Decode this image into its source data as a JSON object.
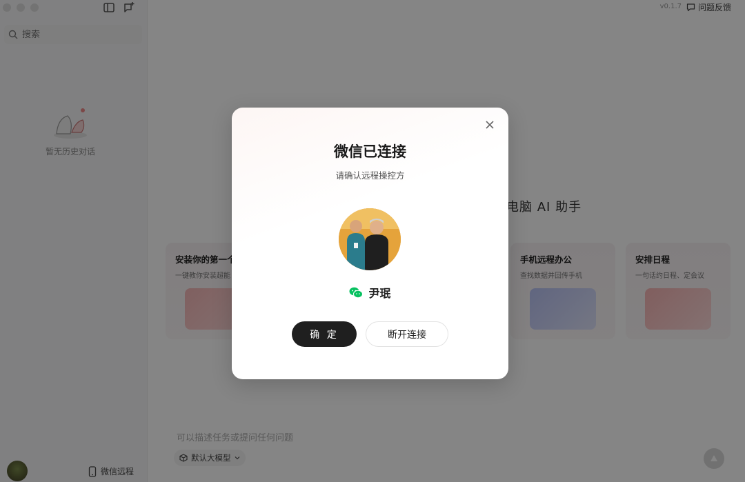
{
  "sidebar": {
    "search_placeholder": "搜索",
    "empty_history": "暂无历史对话",
    "wechat_remote": "微信远程"
  },
  "header": {
    "version": "v0.1.7",
    "feedback": "问题反馈"
  },
  "main": {
    "hero_title": "电脑 AI 助手",
    "cards": [
      {
        "title": "安装你的第一个",
        "desc": "一键教你安装超能"
      },
      {
        "title": "手机远程办公",
        "desc": "查找数据并回传手机"
      },
      {
        "title": "安排日程",
        "desc": "一句话约日程、定会议"
      }
    ],
    "input_hint": "可以描述任务或提问任何问题",
    "model_label": "默认大模型"
  },
  "modal": {
    "title": "微信已连接",
    "subtitle": "请确认远程操控方",
    "user_name": "尹珉",
    "confirm_label": "确 定",
    "disconnect_label": "断开连接"
  },
  "colors": {
    "accent_dark": "#1f1f1f",
    "wechat_green": "#07c160",
    "overlay": "rgba(0,0,0,0.48)"
  },
  "icons": [
    "search-icon",
    "sidebar-toggle-icon",
    "new-chat-icon",
    "feedback-icon",
    "phone-icon",
    "model-icon",
    "chevron-down-icon",
    "send-icon",
    "close-icon",
    "wechat-icon"
  ]
}
